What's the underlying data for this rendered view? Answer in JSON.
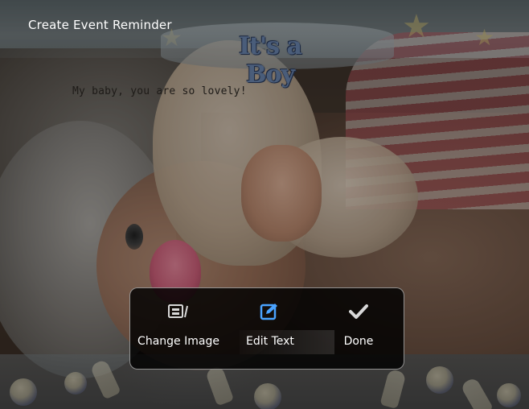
{
  "header": {
    "title": "Create Event Reminder"
  },
  "photo": {
    "banner_text": "It's a Boy",
    "caption": "My baby, you are so lovely!"
  },
  "menu": {
    "items": [
      {
        "label": "Change Image",
        "icon": "change-image-icon"
      },
      {
        "label": "Edit Text",
        "icon": "edit-text-icon",
        "accent": "#4aa3ff"
      },
      {
        "label": "Done",
        "icon": "checkmark-icon"
      }
    ]
  }
}
